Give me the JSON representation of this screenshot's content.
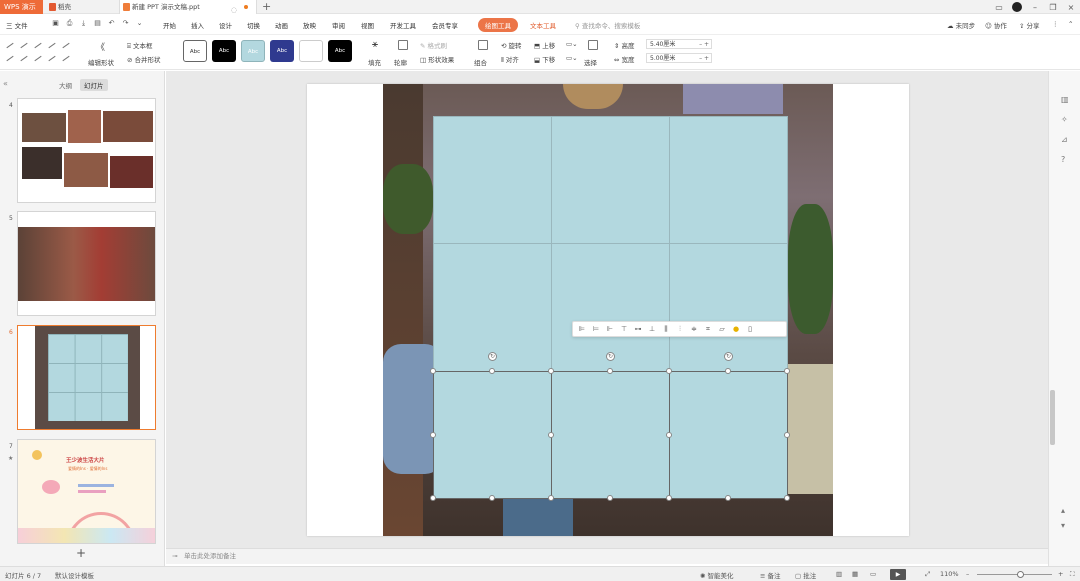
{
  "titlebar": {
    "app_name": "WPS 演示",
    "tab_doc": "稻壳",
    "tab_ppt": "新建 PPT 演示文稿.ppt",
    "add_tab": "+"
  },
  "menubar": {
    "file": "三 文件",
    "items": [
      "开始",
      "插入",
      "设计",
      "切换",
      "动画",
      "放映",
      "审阅",
      "视图",
      "开发工具",
      "会员专享"
    ],
    "active_tool": "绘图工具",
    "text_tool": "文本工具",
    "search_placeholder": "查找命令、搜索模板",
    "right_items": [
      "未同步",
      "协作",
      "分享"
    ]
  },
  "ribbon": {
    "edit_shape": "编辑形状",
    "textbox": "文本框",
    "merge_shape": "合并形状",
    "style_labels": [
      "Abc",
      "Abc",
      "Abc",
      "Abc",
      "",
      "Abc"
    ],
    "fill": "填充",
    "outline": "轮廓",
    "shape_effect": "形状效果",
    "format_painter": "格式刷",
    "group": "组合",
    "rotate": "旋转",
    "align": "对齐",
    "move_up": "上移",
    "move_down": "下移",
    "select": "选择",
    "height_label": "高度",
    "width_label": "宽度",
    "height_value": "5.40厘米",
    "width_value": "5.00厘米"
  },
  "leftpane": {
    "tab_outline": "大纲",
    "tab_slides": "幻灯片",
    "thumbs": [
      {
        "num": "4"
      },
      {
        "num": "5"
      },
      {
        "num": "6"
      },
      {
        "num": "7"
      }
    ],
    "slide7_title": "王少波生活大片",
    "slide7_sub": "爱情的Ins · 爱情的Ins",
    "add_slide": "+"
  },
  "notes": {
    "placeholder": "单击此处添加备注"
  },
  "statusbar": {
    "slide_count": "幻灯片 6 / 7",
    "theme": "默认设计模板",
    "beautify": "智能美化",
    "comments": "备注",
    "annotate": "批注",
    "zoom": "110%"
  },
  "colors": {
    "accent": "#ee7c2f",
    "cell_fill": "#b3d8df",
    "wps_brand": "#ee6b38"
  }
}
